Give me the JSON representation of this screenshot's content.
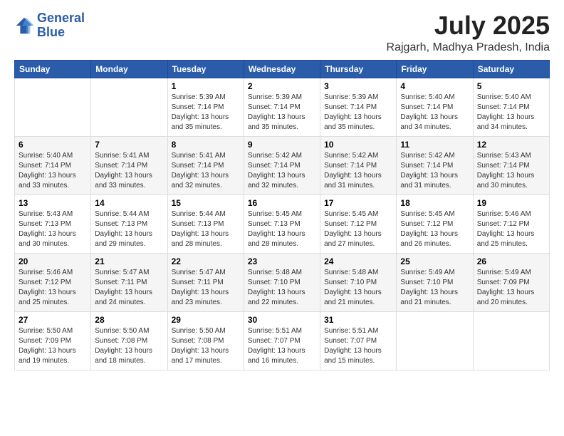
{
  "header": {
    "logo": {
      "line1": "General",
      "line2": "Blue"
    },
    "month": "July 2025",
    "location": "Rajgarh, Madhya Pradesh, India"
  },
  "weekdays": [
    "Sunday",
    "Monday",
    "Tuesday",
    "Wednesday",
    "Thursday",
    "Friday",
    "Saturday"
  ],
  "weeks": [
    [
      {
        "day": "",
        "info": ""
      },
      {
        "day": "",
        "info": ""
      },
      {
        "day": "1",
        "info": "Sunrise: 5:39 AM\nSunset: 7:14 PM\nDaylight: 13 hours and 35 minutes."
      },
      {
        "day": "2",
        "info": "Sunrise: 5:39 AM\nSunset: 7:14 PM\nDaylight: 13 hours and 35 minutes."
      },
      {
        "day": "3",
        "info": "Sunrise: 5:39 AM\nSunset: 7:14 PM\nDaylight: 13 hours and 35 minutes."
      },
      {
        "day": "4",
        "info": "Sunrise: 5:40 AM\nSunset: 7:14 PM\nDaylight: 13 hours and 34 minutes."
      },
      {
        "day": "5",
        "info": "Sunrise: 5:40 AM\nSunset: 7:14 PM\nDaylight: 13 hours and 34 minutes."
      }
    ],
    [
      {
        "day": "6",
        "info": "Sunrise: 5:40 AM\nSunset: 7:14 PM\nDaylight: 13 hours and 33 minutes."
      },
      {
        "day": "7",
        "info": "Sunrise: 5:41 AM\nSunset: 7:14 PM\nDaylight: 13 hours and 33 minutes."
      },
      {
        "day": "8",
        "info": "Sunrise: 5:41 AM\nSunset: 7:14 PM\nDaylight: 13 hours and 32 minutes."
      },
      {
        "day": "9",
        "info": "Sunrise: 5:42 AM\nSunset: 7:14 PM\nDaylight: 13 hours and 32 minutes."
      },
      {
        "day": "10",
        "info": "Sunrise: 5:42 AM\nSunset: 7:14 PM\nDaylight: 13 hours and 31 minutes."
      },
      {
        "day": "11",
        "info": "Sunrise: 5:42 AM\nSunset: 7:14 PM\nDaylight: 13 hours and 31 minutes."
      },
      {
        "day": "12",
        "info": "Sunrise: 5:43 AM\nSunset: 7:14 PM\nDaylight: 13 hours and 30 minutes."
      }
    ],
    [
      {
        "day": "13",
        "info": "Sunrise: 5:43 AM\nSunset: 7:13 PM\nDaylight: 13 hours and 30 minutes."
      },
      {
        "day": "14",
        "info": "Sunrise: 5:44 AM\nSunset: 7:13 PM\nDaylight: 13 hours and 29 minutes."
      },
      {
        "day": "15",
        "info": "Sunrise: 5:44 AM\nSunset: 7:13 PM\nDaylight: 13 hours and 28 minutes."
      },
      {
        "day": "16",
        "info": "Sunrise: 5:45 AM\nSunset: 7:13 PM\nDaylight: 13 hours and 28 minutes."
      },
      {
        "day": "17",
        "info": "Sunrise: 5:45 AM\nSunset: 7:12 PM\nDaylight: 13 hours and 27 minutes."
      },
      {
        "day": "18",
        "info": "Sunrise: 5:45 AM\nSunset: 7:12 PM\nDaylight: 13 hours and 26 minutes."
      },
      {
        "day": "19",
        "info": "Sunrise: 5:46 AM\nSunset: 7:12 PM\nDaylight: 13 hours and 25 minutes."
      }
    ],
    [
      {
        "day": "20",
        "info": "Sunrise: 5:46 AM\nSunset: 7:12 PM\nDaylight: 13 hours and 25 minutes."
      },
      {
        "day": "21",
        "info": "Sunrise: 5:47 AM\nSunset: 7:11 PM\nDaylight: 13 hours and 24 minutes."
      },
      {
        "day": "22",
        "info": "Sunrise: 5:47 AM\nSunset: 7:11 PM\nDaylight: 13 hours and 23 minutes."
      },
      {
        "day": "23",
        "info": "Sunrise: 5:48 AM\nSunset: 7:10 PM\nDaylight: 13 hours and 22 minutes."
      },
      {
        "day": "24",
        "info": "Sunrise: 5:48 AM\nSunset: 7:10 PM\nDaylight: 13 hours and 21 minutes."
      },
      {
        "day": "25",
        "info": "Sunrise: 5:49 AM\nSunset: 7:10 PM\nDaylight: 13 hours and 21 minutes."
      },
      {
        "day": "26",
        "info": "Sunrise: 5:49 AM\nSunset: 7:09 PM\nDaylight: 13 hours and 20 minutes."
      }
    ],
    [
      {
        "day": "27",
        "info": "Sunrise: 5:50 AM\nSunset: 7:09 PM\nDaylight: 13 hours and 19 minutes."
      },
      {
        "day": "28",
        "info": "Sunrise: 5:50 AM\nSunset: 7:08 PM\nDaylight: 13 hours and 18 minutes."
      },
      {
        "day": "29",
        "info": "Sunrise: 5:50 AM\nSunset: 7:08 PM\nDaylight: 13 hours and 17 minutes."
      },
      {
        "day": "30",
        "info": "Sunrise: 5:51 AM\nSunset: 7:07 PM\nDaylight: 13 hours and 16 minutes."
      },
      {
        "day": "31",
        "info": "Sunrise: 5:51 AM\nSunset: 7:07 PM\nDaylight: 13 hours and 15 minutes."
      },
      {
        "day": "",
        "info": ""
      },
      {
        "day": "",
        "info": ""
      }
    ]
  ]
}
